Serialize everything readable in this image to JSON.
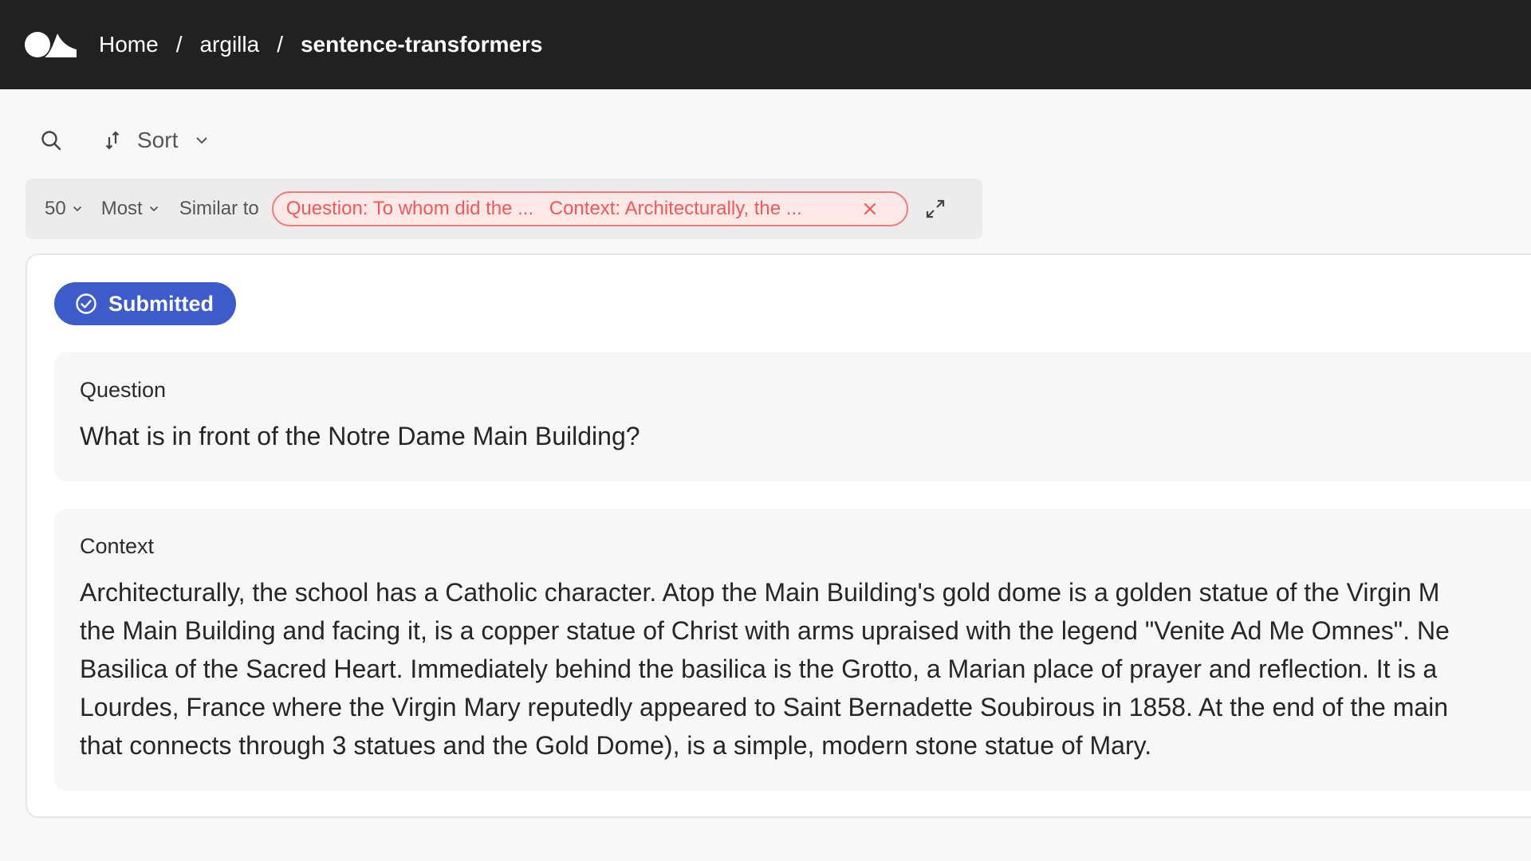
{
  "breadcrumb": {
    "home": "Home",
    "separator": "/",
    "org": "argilla",
    "dataset": "sentence-transformers"
  },
  "toolbar": {
    "sort_label": "Sort"
  },
  "similarity": {
    "limit": "50",
    "order": "Most",
    "label": "Similar to",
    "chip_question": "Question: To whom did the ...",
    "chip_context": "Context: Architecturally, the ..."
  },
  "record": {
    "status": "Submitted",
    "question_title": "Question",
    "question_text": "What is in front of the Notre Dame Main Building?",
    "context_title": "Context",
    "context_lines": [
      "Architecturally, the school has a Catholic character. Atop the Main Building's gold dome is a golden statue of the Virgin M",
      "the Main Building and facing it, is a copper statue of Christ with arms upraised with the legend \"Venite Ad Me Omnes\". Ne",
      "Basilica of the Sacred Heart. Immediately behind the basilica is the Grotto, a Marian place of prayer and reflection. It is a",
      "Lourdes, France where the Virgin Mary reputedly appeared to Saint Bernadette Soubirous in 1858. At the end of the main",
      "that connects through 3 statues and the Gold Dome), is a simple, modern stone statue of Mary."
    ]
  },
  "colors": {
    "topbar": "#212121",
    "accent": "#3e5cc9",
    "chip_text": "#ee5a5a",
    "chip_border": "#f07b7b"
  },
  "icons": {
    "logo": "argilla-logo-icon",
    "search": "search-icon",
    "sort": "sort-arrows-icon",
    "chevron": "chevron-down-icon",
    "close": "close-icon",
    "expand": "expand-icon",
    "check": "check-circle-icon"
  }
}
